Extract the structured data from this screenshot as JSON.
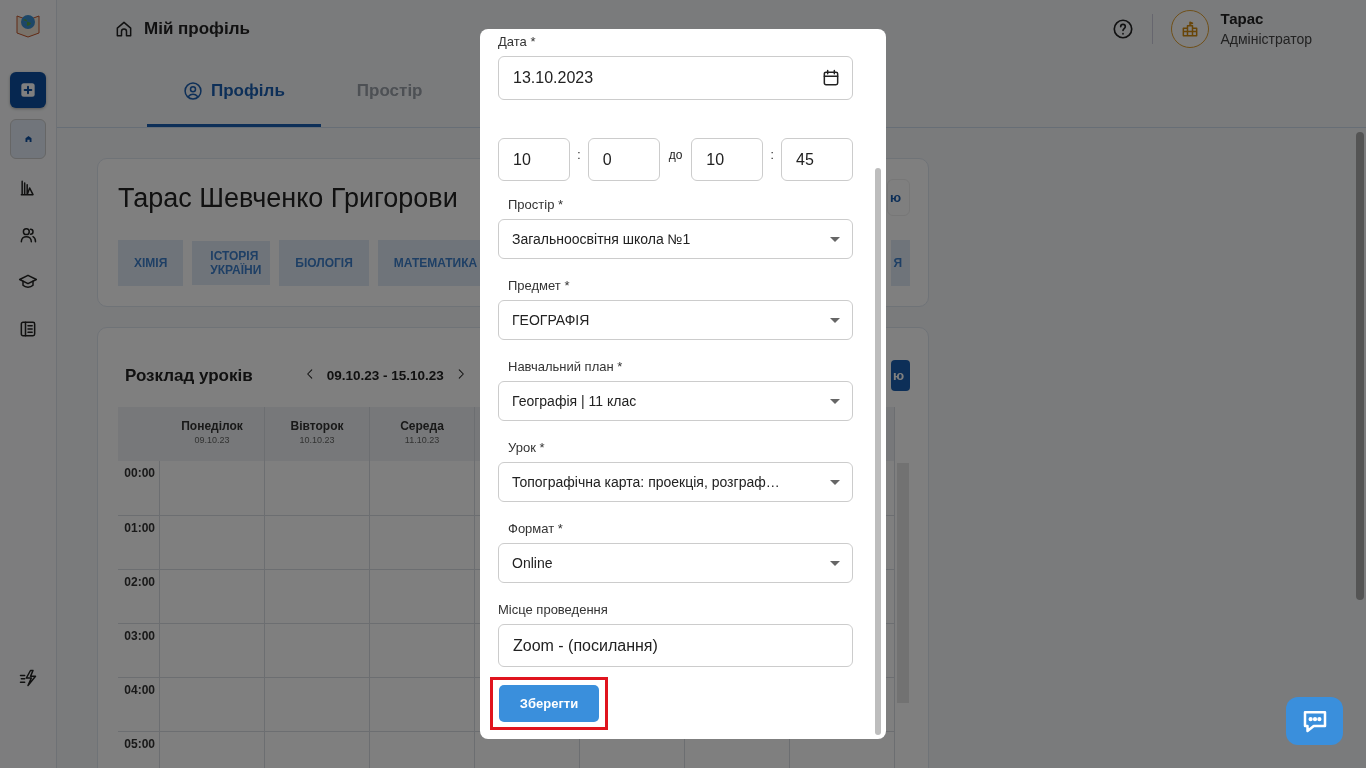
{
  "sidebar": {
    "items": [
      {
        "kind": "action",
        "selected": false
      },
      {
        "kind": "nav",
        "selected": true
      },
      {
        "kind": "nav",
        "selected": false
      },
      {
        "kind": "nav",
        "selected": false
      },
      {
        "kind": "nav",
        "selected": false
      },
      {
        "kind": "nav",
        "selected": false
      }
    ]
  },
  "header": {
    "title": "Мій профіль",
    "user": {
      "name": "Тарас",
      "role": "Адміністратор"
    }
  },
  "tabs": [
    {
      "label": "Профіль",
      "selected": true
    },
    {
      "label": "Простір",
      "selected": false
    }
  ],
  "profile": {
    "name": "Тарас Шевченко Григорови",
    "edit_button": "ю",
    "tags": [
      "ХІМІЯ",
      "ІСТОРІЯ УКРАЇНИ",
      "БІОЛОГІЯ",
      "МАТЕМАТИКА"
    ],
    "tag_fragment": "Я"
  },
  "schedule": {
    "title": "Розклад уроків",
    "range": "09.10.23 - 15.10.23",
    "button": "ю",
    "days": [
      {
        "name": "Понеділок",
        "date": "09.10.23"
      },
      {
        "name": "Вівторок",
        "date": "10.10.23"
      },
      {
        "name": "Середа",
        "date": "11.10.23"
      }
    ],
    "times": [
      "00:00",
      "01:00",
      "02:00",
      "03:00",
      "04:00",
      "05:00"
    ]
  },
  "dialog": {
    "date": {
      "label": "Дата *",
      "value": "13.10.2023"
    },
    "time": {
      "start_hour": "10",
      "start_minute": "0",
      "separator": ":",
      "to": "до",
      "end_hour": "10",
      "end_minute": "45"
    },
    "selects": [
      {
        "label": "Простір *",
        "value": "Загальноосвітня школа №1"
      },
      {
        "label": "Предмет *",
        "value": "ГЕОГРАФІЯ"
      },
      {
        "label": "Навчальний план *",
        "value": "Географія | 11 клас"
      },
      {
        "label": "Урок *",
        "value": "Топографічна карта: проекція, розграф…"
      },
      {
        "label": "Формат *",
        "value": "Online"
      }
    ],
    "location": {
      "label": "Місце проведення",
      "value": "Zoom - (посилання)"
    },
    "save_button": "Зберегти",
    "save_highlighted": true
  }
}
